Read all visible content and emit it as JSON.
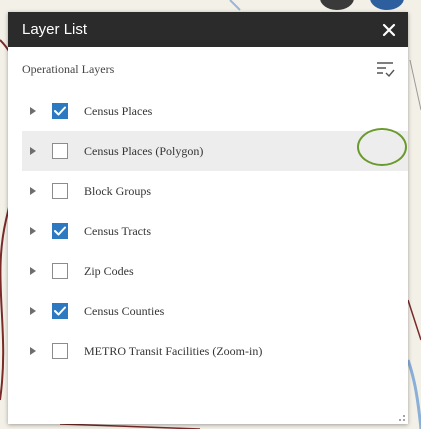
{
  "panel": {
    "title": "Layer List",
    "close_icon": "close-icon",
    "section_label": "Operational Layers",
    "options_icon": "layer-options-icon"
  },
  "layers": [
    {
      "label": "Census Places",
      "checked": true
    },
    {
      "label": "Census Places (Polygon)",
      "checked": false,
      "highlighted": true
    },
    {
      "label": "Block Groups",
      "checked": false
    },
    {
      "label": "Census Tracts",
      "checked": true
    },
    {
      "label": "Zip Codes",
      "checked": false
    },
    {
      "label": "Census Counties",
      "checked": true
    },
    {
      "label": "METRO Transit Facilities (Zoom-in)",
      "checked": false
    }
  ],
  "colors": {
    "header_bg": "#2b2b2b",
    "checkbox_checked": "#2d79c1",
    "row_highlight": "#ededed",
    "annotation_ring": "#6a9a2e"
  }
}
